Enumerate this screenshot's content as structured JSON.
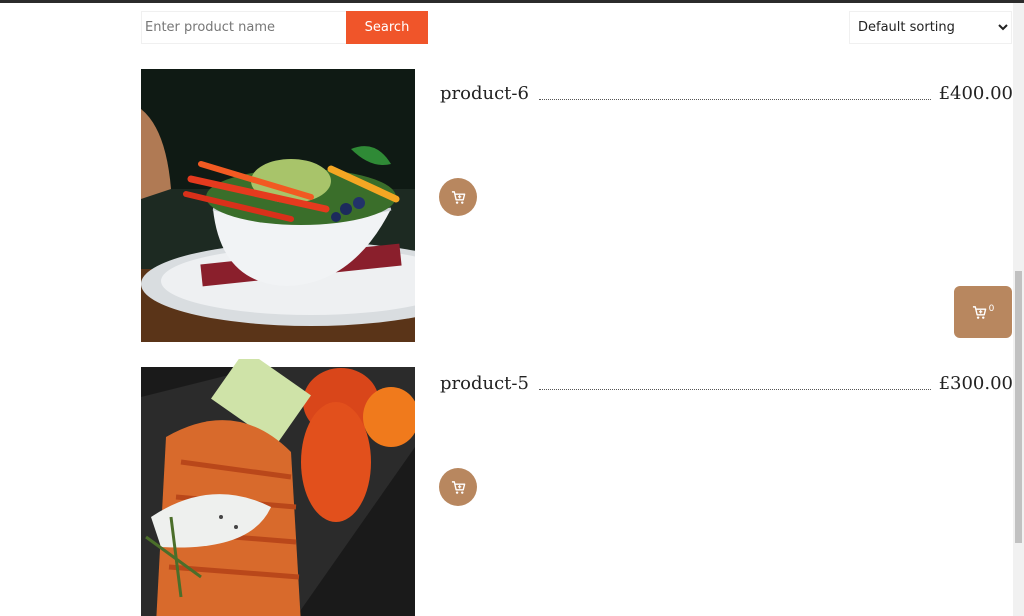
{
  "search": {
    "placeholder": "Enter product name",
    "button_label": "Search"
  },
  "sorting": {
    "selected": "Default sorting"
  },
  "products": [
    {
      "name": "product-6",
      "price": "£400.00",
      "image": "salad-bowl-image"
    },
    {
      "name": "product-5",
      "price": "£300.00",
      "image": "grilled-salmon-image"
    }
  ],
  "floating_cart": {
    "count": "0",
    "icon": "cart-icon"
  },
  "colors": {
    "accent": "#f0552a",
    "cart": "#b8875f"
  }
}
